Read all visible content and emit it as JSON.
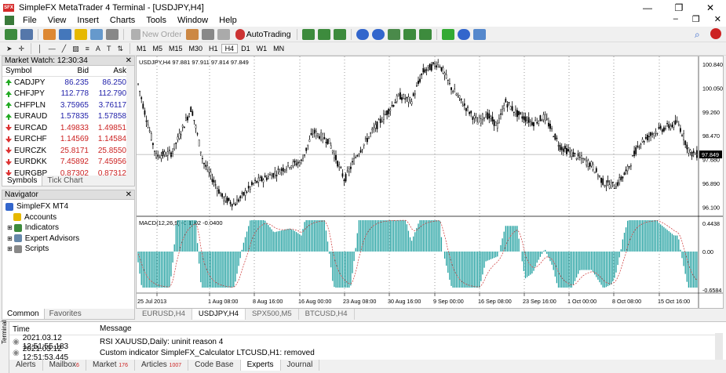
{
  "window": {
    "title": "SimpleFX MetaTrader 4 Terminal - [USDJPY,H4]",
    "logo": "SFX",
    "min": "—",
    "max": "❐",
    "close": "✕"
  },
  "menu": {
    "items": [
      "File",
      "View",
      "Insert",
      "Charts",
      "Tools",
      "Window",
      "Help"
    ],
    "mdi": [
      "–",
      "❐",
      "✕"
    ]
  },
  "toolbar": {
    "new_order": "New Order",
    "autotrading": "AutoTrading"
  },
  "timeframes": [
    "M1",
    "M5",
    "M15",
    "M30",
    "H1",
    "H4",
    "D1",
    "W1",
    "MN"
  ],
  "market_watch": {
    "title": "Market Watch: 12:30:34",
    "columns": [
      "Symbol",
      "Bid",
      "Ask"
    ],
    "rows": [
      {
        "symbol": "CADJPY",
        "bid": "86.235",
        "ask": "86.250",
        "dir": "up"
      },
      {
        "symbol": "CHFJPY",
        "bid": "112.778",
        "ask": "112.790",
        "dir": "up"
      },
      {
        "symbol": "CHFPLN",
        "bid": "3.75965",
        "ask": "3.76117",
        "dir": "up"
      },
      {
        "symbol": "EURAUD",
        "bid": "1.57835",
        "ask": "1.57858",
        "dir": "up"
      },
      {
        "symbol": "EURCAD",
        "bid": "1.49833",
        "ask": "1.49851",
        "dir": "down"
      },
      {
        "symbol": "EURCHF",
        "bid": "1.14569",
        "ask": "1.14584",
        "dir": "down"
      },
      {
        "symbol": "EURCZK",
        "bid": "25.8171",
        "ask": "25.8550",
        "dir": "down"
      },
      {
        "symbol": "EURDKK",
        "bid": "7.45892",
        "ask": "7.45956",
        "dir": "down"
      },
      {
        "symbol": "EURGBP",
        "bid": "0.87302",
        "ask": "0.87312",
        "dir": "down"
      }
    ],
    "tabs": [
      "Symbols",
      "Tick Chart"
    ]
  },
  "navigator": {
    "title": "Navigator",
    "items": [
      "SimpleFX MT4",
      "Accounts",
      "Indicators",
      "Expert Advisors",
      "Scripts"
    ],
    "tabs": [
      "Common",
      "Favorites"
    ]
  },
  "chart": {
    "header": "USDJPY,H4  97.881 97.911 97.814 97.849",
    "current_price": "97.849",
    "price_ticks": [
      "100.840",
      "100.050",
      "99.260",
      "98.470",
      "97.680",
      "96.890",
      "96.100"
    ],
    "macd_header": "MACD(12,26,9) -0.1102 -0.0400",
    "macd_ticks": [
      "0.4438",
      "0.00",
      "-0.6584"
    ],
    "time_ticks": [
      "25 Jul 2013",
      "1 Aug 08:00",
      "8 Aug 16:00",
      "16 Aug 00:00",
      "23 Aug 08:00",
      "30 Aug 16:00",
      "9 Sep 00:00",
      "16 Sep 08:00",
      "23 Sep 16:00",
      "1 Oct 00:00",
      "8 Oct 08:00",
      "15 Oct 16:00"
    ],
    "colors": {
      "candle": "#000000",
      "macd": "#20a0a0",
      "signal": "#cc3333"
    }
  },
  "chart_tabs": [
    "EURUSD,H4",
    "USDJPY,H4",
    "SPX500,M5",
    "BTCUSD,H4"
  ],
  "terminal": {
    "side_label": "Terminal",
    "columns": [
      "Time",
      "Message"
    ],
    "rows": [
      {
        "time": "2021.03.12 12:51:55.183",
        "msg": "RSI XAUUSD,Daily: uninit reason 4"
      },
      {
        "time": "2021.03.12 12:51:53.445",
        "msg": "Custom indicator SimpleFX_Calculator LTCUSD,H1: removed"
      }
    ],
    "tabs": [
      {
        "label": "Alerts",
        "badge": ""
      },
      {
        "label": "Mailbox",
        "badge": "6"
      },
      {
        "label": "Market",
        "badge": "176"
      },
      {
        "label": "Articles",
        "badge": "1007"
      },
      {
        "label": "Code Base",
        "badge": ""
      },
      {
        "label": "Experts",
        "badge": ""
      },
      {
        "label": "Journal",
        "badge": ""
      }
    ]
  }
}
